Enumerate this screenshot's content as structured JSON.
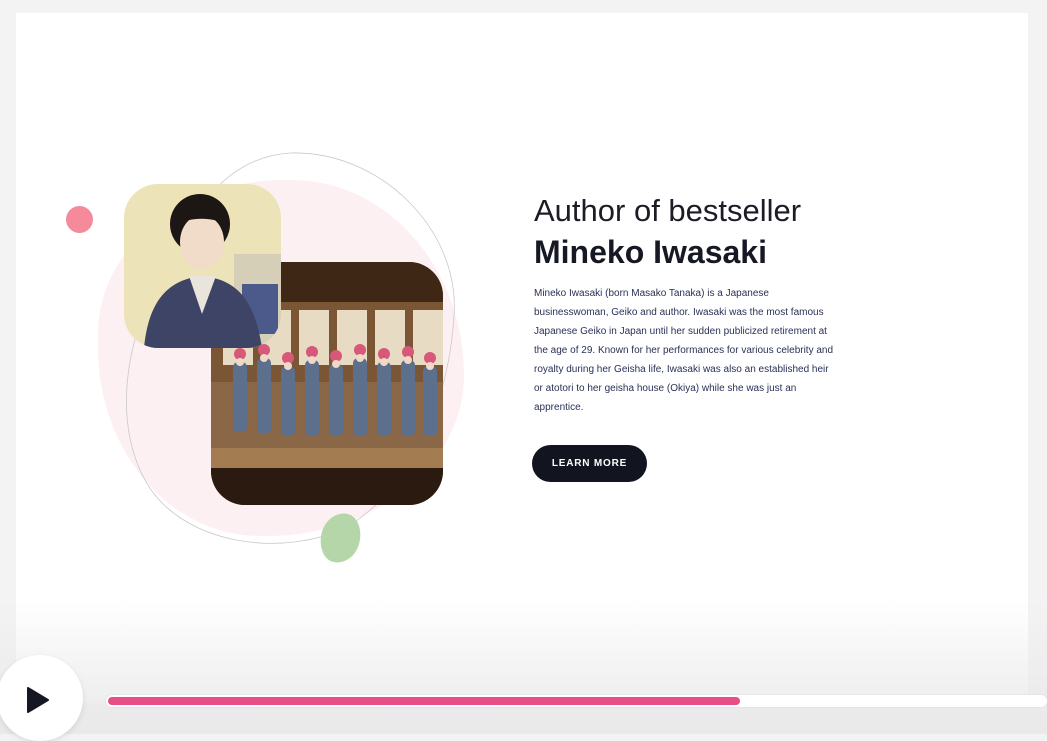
{
  "hero": {
    "subtitle": "Author of bestseller",
    "title": "Mineko Iwasaki",
    "description": "Mineko Iwasaki (born Masako Tanaka) is a Japanese businesswoman, Geiko and author. Iwasaki was the most famous Japanese Geiko in Japan until her sudden publicized retirement at the age of 29. Known for her performances for various celebrity and royalty during her Geisha life, Iwasaki was also an established heir or atotori to her geisha house (Okiya) while she was just an apprentice.",
    "button_label": "LEARN MORE"
  },
  "images": {
    "portrait": "portrait-photo",
    "stage": "geiko-dance-stage-photo"
  },
  "player": {
    "progress": 0.675,
    "play_icon": "play-icon"
  },
  "colors": {
    "accent_pink": "#e84e86",
    "blob_pink": "#fdf0f2",
    "dot_pink": "#f48a9a",
    "dot_green": "#b5d6a8",
    "button_dark": "#12151f"
  }
}
